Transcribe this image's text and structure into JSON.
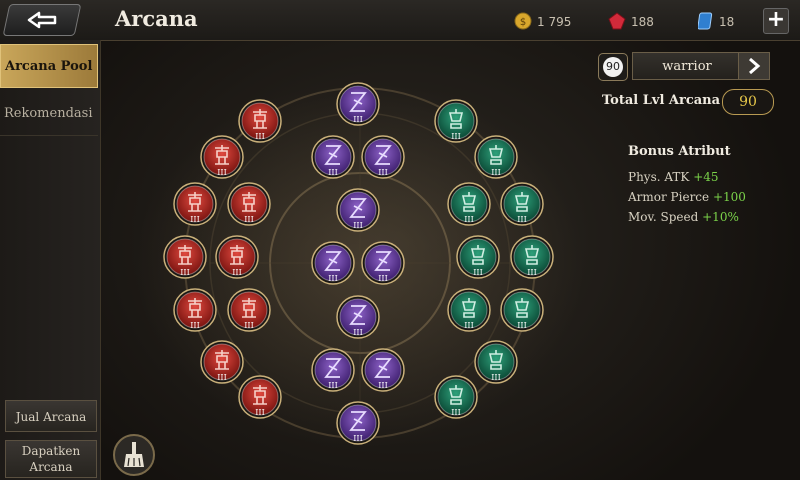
{
  "header": {
    "title": "Arcana",
    "gold": "1 795",
    "gems": "188",
    "vouchers": "18",
    "plus_label": "+"
  },
  "sidebar": {
    "tabs": [
      {
        "label": "Arcana Pool",
        "active": true
      },
      {
        "label": "Rekomendasi",
        "active": false
      }
    ],
    "sell_label": "Jual Arcana",
    "get_label_line1": "Dapatken",
    "get_label_line2": "Arcana"
  },
  "board": {
    "level_mark": "III",
    "colors": {
      "red": "#b8221e",
      "purple": "#6a3aa8",
      "green": "#157a58",
      "ring": "#c9b07a"
    }
  },
  "panel": {
    "level_badge": "90",
    "hero": "warrior",
    "total_label": "Total Lvl Arcana",
    "total_value": "90",
    "bonus_title": "Bonus Atribut",
    "attributes": [
      {
        "name": "Phys. ATK",
        "value": "+45"
      },
      {
        "name": "Armor Pierce",
        "value": "+100"
      },
      {
        "name": "Mov. Speed",
        "value": "+10%"
      }
    ]
  }
}
